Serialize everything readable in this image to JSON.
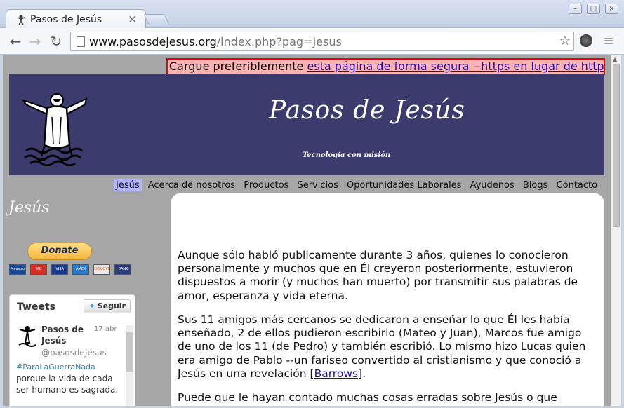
{
  "browser": {
    "tab_title": "Pasos de Jesús",
    "tab_close": "×",
    "url_host": "www.pasosdejesus.org",
    "url_path": "/index.php?pag=Jesus",
    "back": "←",
    "forward": "→",
    "reload": "↻",
    "star": "☆",
    "menu": "≡",
    "minimize": "–",
    "maximize": "□",
    "close": "×"
  },
  "notice": {
    "prefix": "Cargue preferiblemente ",
    "link": "esta página de forma segura --https en lugar de http"
  },
  "banner": {
    "title": "Pasos de Jesús",
    "slogan": "Tecnología con misión"
  },
  "nav": {
    "items": [
      "Jesús",
      "Acerca de nosotros",
      "Productos",
      "Servicios",
      "Oportunidades Laborales",
      "Ayudenos",
      "Blogs",
      "Contacto"
    ]
  },
  "sidebar": {
    "title": "Jesús",
    "donate_label": "Donate",
    "cards": [
      "Maestro",
      "MC",
      "VISA",
      "AMEX",
      "DISCOVER",
      "BANK"
    ]
  },
  "tweets": {
    "header": "Tweets",
    "follow_label": "Seguir",
    "author_name": "Pasos de Jesús",
    "author_handle": "@pasosdeJesus",
    "date": "17 abr",
    "hashtag": "#ParaLaGuerraNada",
    "text": "porque la vida de cada ser humano es sagrada."
  },
  "content": {
    "p1": "Aunque sólo habló publicamente durante 3 años, quienes lo conocieron personalmente y muchos que en Él creyeron posteriormente, estuvieron dispuestos a morir (y muchos han muerto) por transmitir sus palabras de amor, esperanza y vida eterna.",
    "p2_before": "Sus 11 amigos más cercanos se dedicaron a enseñar lo que Él les había enseñado, 2 de ellos pudieron escribirlo (Mateo y Juan), Marcos fue amigo de uno de los 11 (de Pedro) y también escribió. Lo mismo hizo Lucas quien era amigo de Pablo --un fariseo convertido al cristianismo y que conoció a Jesús en una revelación [",
    "p2_link": "Barrows",
    "p2_after": "].",
    "p3": "Puede que le hayan contado muchas cosas erradas sobre Jesús o que"
  },
  "colors": {
    "banner_bg": "#3b3b6e",
    "page_bg": "#a6a6a6",
    "notice_bg": "#ffb3b3",
    "notice_border": "#ee0000",
    "nav_active_bg": "#b3b3ff",
    "link": "#1a0dab"
  },
  "icons": [
    "page-icon",
    "bookmark-star-icon",
    "extension-icon",
    "menu-icon",
    "back-icon",
    "forward-icon",
    "reload-icon",
    "twitter-bird-icon"
  ]
}
